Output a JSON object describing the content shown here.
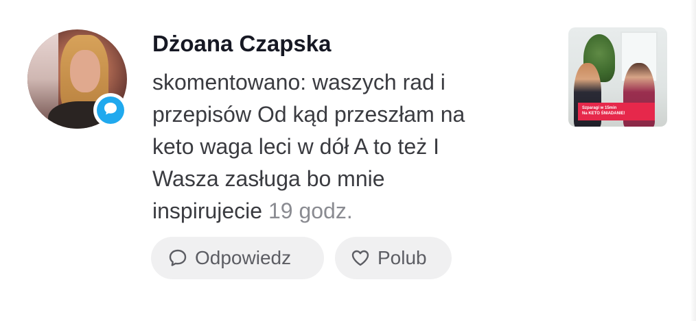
{
  "comment": {
    "author": "Dżoana Czapska",
    "lines": [
      "skomentowano: waszych rad i",
      "przepisów Od kąd przeszłam na",
      "keto waga leci w dół A to też I",
      "Wasza zasługa bo mnie"
    ],
    "last_line_text": "inspirujecie",
    "timestamp": "19 godz."
  },
  "actions": {
    "reply_label": "Odpowiedz",
    "like_label": "Polub"
  },
  "thumbnail": {
    "caption_line1": "Szparagi w 15min",
    "caption_line2": "Na KETO ŚNIADANIE!"
  },
  "icons": {
    "badge": "comment-bubble-icon",
    "reply": "speech-bubble-icon",
    "like": "heart-icon"
  },
  "colors": {
    "badge_blue": "#20a9ee",
    "caption_red": "#e6284b",
    "timestamp_gray": "#8a8b91"
  }
}
